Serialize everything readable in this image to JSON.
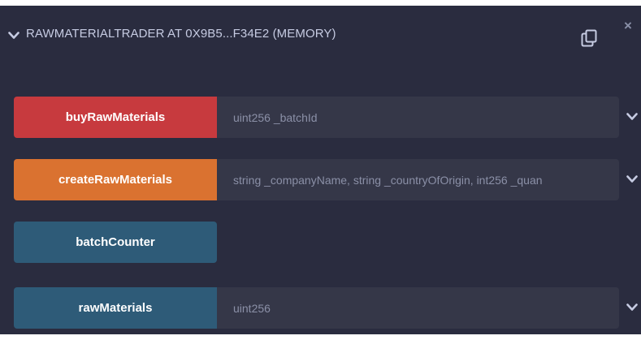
{
  "header": {
    "title": "RAWMATERIALTRADER AT 0X9B5...F34E2 (MEMORY)",
    "close_glyph": "×"
  },
  "functions": [
    {
      "label": "buyRawMaterials",
      "placeholder": "uint256 _batchId",
      "color": "#c73a3e"
    },
    {
      "label": "createRawMaterials",
      "placeholder": "string _companyName, string _countryOfOrigin, int256 _quan",
      "color": "#da7230"
    },
    {
      "label": "batchCounter",
      "color": "#2e5b78"
    },
    {
      "label": "rawMaterials",
      "placeholder": "uint256",
      "color": "#2e5b78"
    }
  ],
  "icons": {
    "header_chevron": "chevron-down-icon",
    "copy": "copy-icon",
    "close": "close-icon"
  },
  "colors": {
    "panel_bg": "#2a2c3f",
    "input_bg": "#353748",
    "text": "#c6cbe2"
  }
}
